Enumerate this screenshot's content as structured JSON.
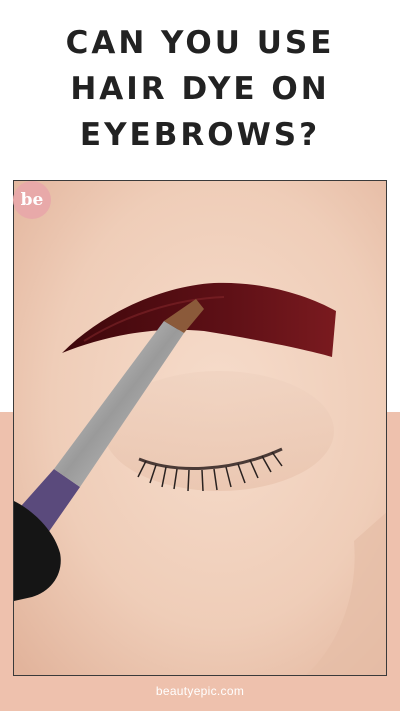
{
  "title": {
    "line1": "CAN YOU USE",
    "line2": "HAIR DYE ON",
    "line3": "EYEBROWS?"
  },
  "logo": {
    "text": "be"
  },
  "footer": {
    "site": "beautyepic.com"
  },
  "colors": {
    "accent_peach": "#eec1ad",
    "title_text": "#222222",
    "dye": "#5a0f14",
    "logo_pink": "#e8a9a9"
  },
  "photo": {
    "subject": "eyebrow-dye-application"
  }
}
